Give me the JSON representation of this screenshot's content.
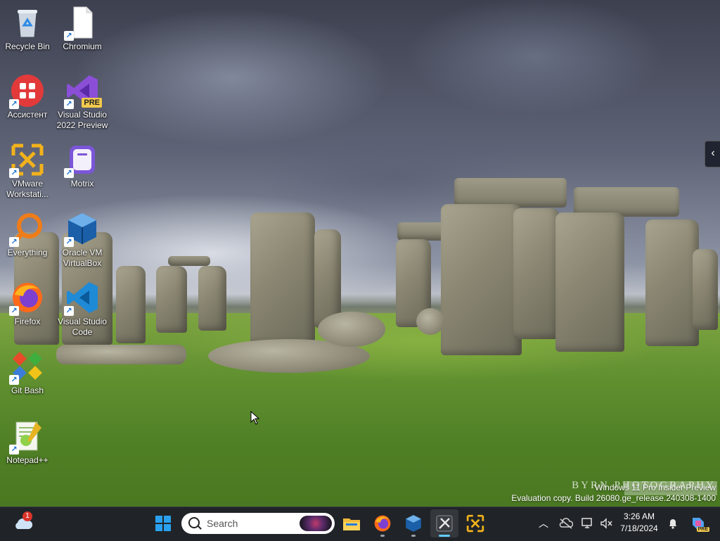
{
  "desktop": {
    "icons": [
      {
        "label": "Recycle Bin"
      },
      {
        "label": "Chromium"
      },
      {
        "label": "Ассистент"
      },
      {
        "label": "Visual Studio 2022 Preview"
      },
      {
        "label": "VMware Workstati..."
      },
      {
        "label": "Motrix"
      },
      {
        "label": "Everything"
      },
      {
        "label": "Oracle VM VirtualBox"
      },
      {
        "label": "Firefox"
      },
      {
        "label": "Visual Studio Code"
      },
      {
        "label": "Git Bash"
      },
      {
        "label": "Notepad++"
      }
    ],
    "vs_badge": "PRE",
    "watermark": {
      "brand": "BYRN",
      "brand_tail": "PHOTOGRAPHY",
      "os_line": "Windows 11 Pro Insider Preview",
      "build_line": "Evaluation copy. Build 26080.ge_release.240308-1400"
    },
    "flyout_icon": "chevron-left-icon"
  },
  "taskbar": {
    "widgets_badge": "1",
    "search_placeholder": "Search",
    "apps": [
      {
        "name": "start",
        "icon": "windows-logo-icon"
      },
      {
        "name": "file-explorer",
        "icon": "folder-icon"
      },
      {
        "name": "firefox",
        "icon": "firefox-icon"
      },
      {
        "name": "virtualbox",
        "icon": "virtualbox-icon"
      },
      {
        "name": "tool-app",
        "icon": "tools-icon"
      },
      {
        "name": "vmware",
        "icon": "vmware-icon"
      }
    ],
    "tray": {
      "overflow_icon": "chevron-up-icon",
      "onedrive_icon": "cloud-offline-icon",
      "network_icon": "network-icon",
      "volume_icon": "volume-muted-icon",
      "time": "3:26 AM",
      "date": "7/18/2024",
      "notification_icon": "bell-icon",
      "copilot_badge": "PRE"
    }
  }
}
